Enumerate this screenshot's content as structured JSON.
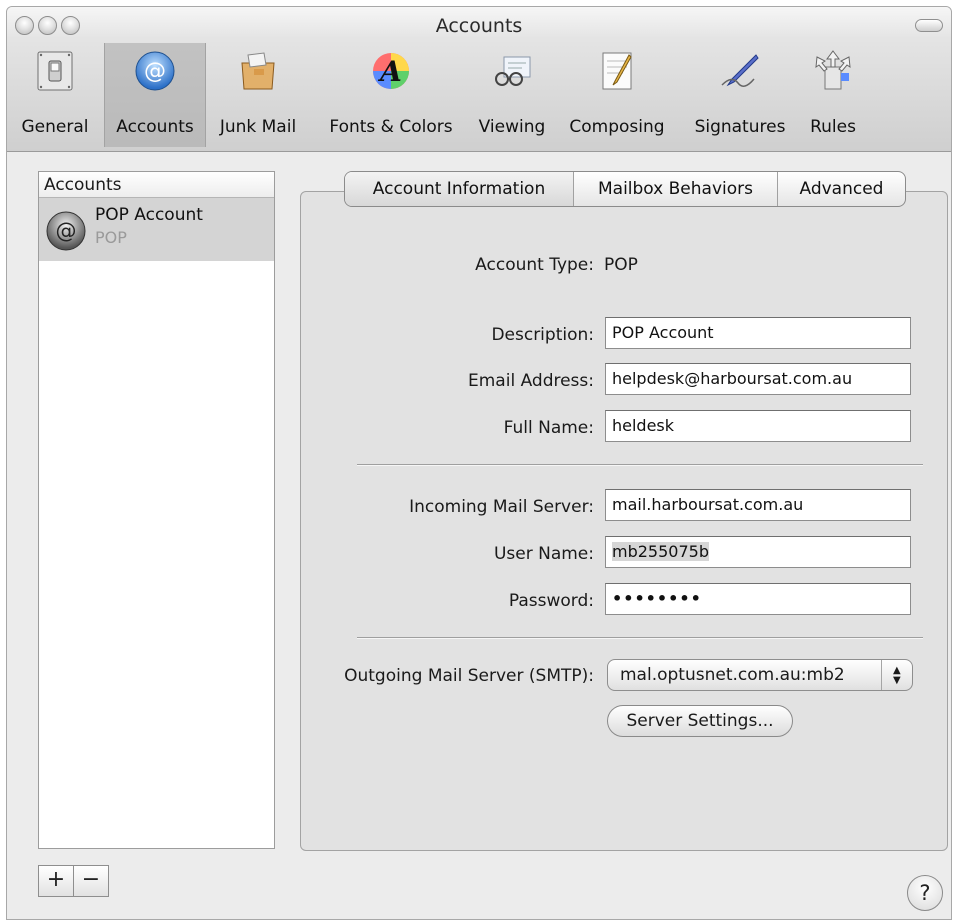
{
  "window": {
    "title": "Accounts"
  },
  "toolbar": {
    "items": [
      {
        "label": "General",
        "icon": "switch-icon"
      },
      {
        "label": "Accounts",
        "icon": "at-sign-icon",
        "selected": true
      },
      {
        "label": "Junk Mail",
        "icon": "junk-mail-icon"
      },
      {
        "label": "Fonts & Colors",
        "icon": "font-a-icon"
      },
      {
        "label": "Viewing",
        "icon": "glasses-icon"
      },
      {
        "label": "Composing",
        "icon": "notepad-pencil-icon"
      },
      {
        "label": "Signatures",
        "icon": "pen-icon"
      },
      {
        "label": "Rules",
        "icon": "arrows-icon"
      }
    ]
  },
  "accounts_list": {
    "header": "Accounts",
    "items": [
      {
        "name": "POP Account",
        "type": "POP"
      }
    ],
    "add_label": "+",
    "remove_label": "−"
  },
  "tabs": [
    {
      "label": "Account Information",
      "selected": true
    },
    {
      "label": "Mailbox Behaviors"
    },
    {
      "label": "Advanced"
    }
  ],
  "form": {
    "account_type_label": "Account Type:",
    "account_type_value": "POP",
    "description_label": "Description:",
    "description_value": "POP Account",
    "email_label": "Email Address:",
    "email_value": "helpdesk@harboursat.com.au",
    "fullname_label": "Full Name:",
    "fullname_value": "heldesk",
    "incoming_label": "Incoming Mail Server:",
    "incoming_value": "mail.harboursat.com.au",
    "username_label": "User Name:",
    "username_value": "mb255075b",
    "password_label": "Password:",
    "password_value": "••••••••",
    "smtp_label": "Outgoing Mail Server (SMTP):",
    "smtp_value": "mal.optusnet.com.au:mb2",
    "server_settings_label": "Server Settings..."
  },
  "help_label": "?",
  "colors": {
    "selected_row": "#d4d4d4",
    "panel": "#e2e2e2"
  }
}
